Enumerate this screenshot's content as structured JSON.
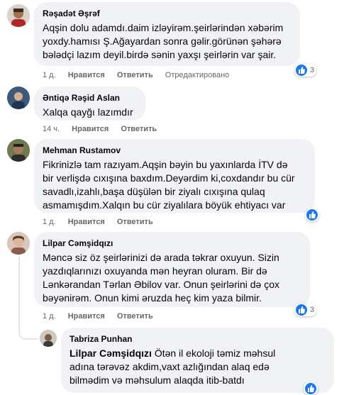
{
  "comments": [
    {
      "author": "Rəşadət Əşrəf",
      "lines": [
        "Aqşin dolu adamdı.daim izləyirəm.şeirlərindən xəbərim",
        "yoxdy.hamısı Ş.Ağayardan sonra gəlir.görünən şəhərə",
        "bələdçi lazım deyil.birdə sənin yaxşı şeirlərin var şair."
      ],
      "time": "1 д.",
      "like": "Нравится",
      "reply": "Ответить",
      "edited": "Отредактировано",
      "reactions": "3"
    },
    {
      "author": "Əntiqə Rəşid Aslan",
      "lines": [
        "Xalqa qayğı lazımdır"
      ],
      "time": "14 ч.",
      "like": "Нравится",
      "reply": "Ответить"
    },
    {
      "author": "Mehman Rustamov",
      "lines": [
        "Fikrinizlə tam razıyam.Aqşin bəyin bu yaxınlarda İTV də",
        "bir verlişdə cıxışına baxdım.Deyərdim ki,coxdandır bu cür",
        "savadlı,izahlı,başa düşülən bir ziyalı cıxışına qulaq",
        "asmamışdım.Xalqın bu cür ziyalılara böyük ehtiyacı var"
      ],
      "time": "1 д.",
      "like": "Нравится",
      "reply": "Ответить"
    },
    {
      "author": "Lilpar Cəmşidqızı",
      "lines": [
        "Məncə siz öz şeirlərinizi də arada təkrar oxuyun. Sizin",
        "yazdıqlarınızı oxuyanda mən heyran oluram. Bir də",
        "Lənkərandan Tərlan Əbilov var. Onun şeirlərini də çox",
        "bəyənirəm. Onun kimi əruzda heç kim yaza bilmir."
      ],
      "time": "1 д.",
      "like": "Нравится",
      "reply": "Ответить",
      "reactions": "3"
    },
    {
      "author": "Tabriza Punhan",
      "mention": "Lilpar Cəmşidqızı",
      "lines": [
        "Ötən il ekoloji təmiz məhsul",
        "adına tərəvəz akdim,vaxt azlığından alaq edə",
        "bilmədim və məhsulum alaqda itib-batdı"
      ]
    }
  ]
}
